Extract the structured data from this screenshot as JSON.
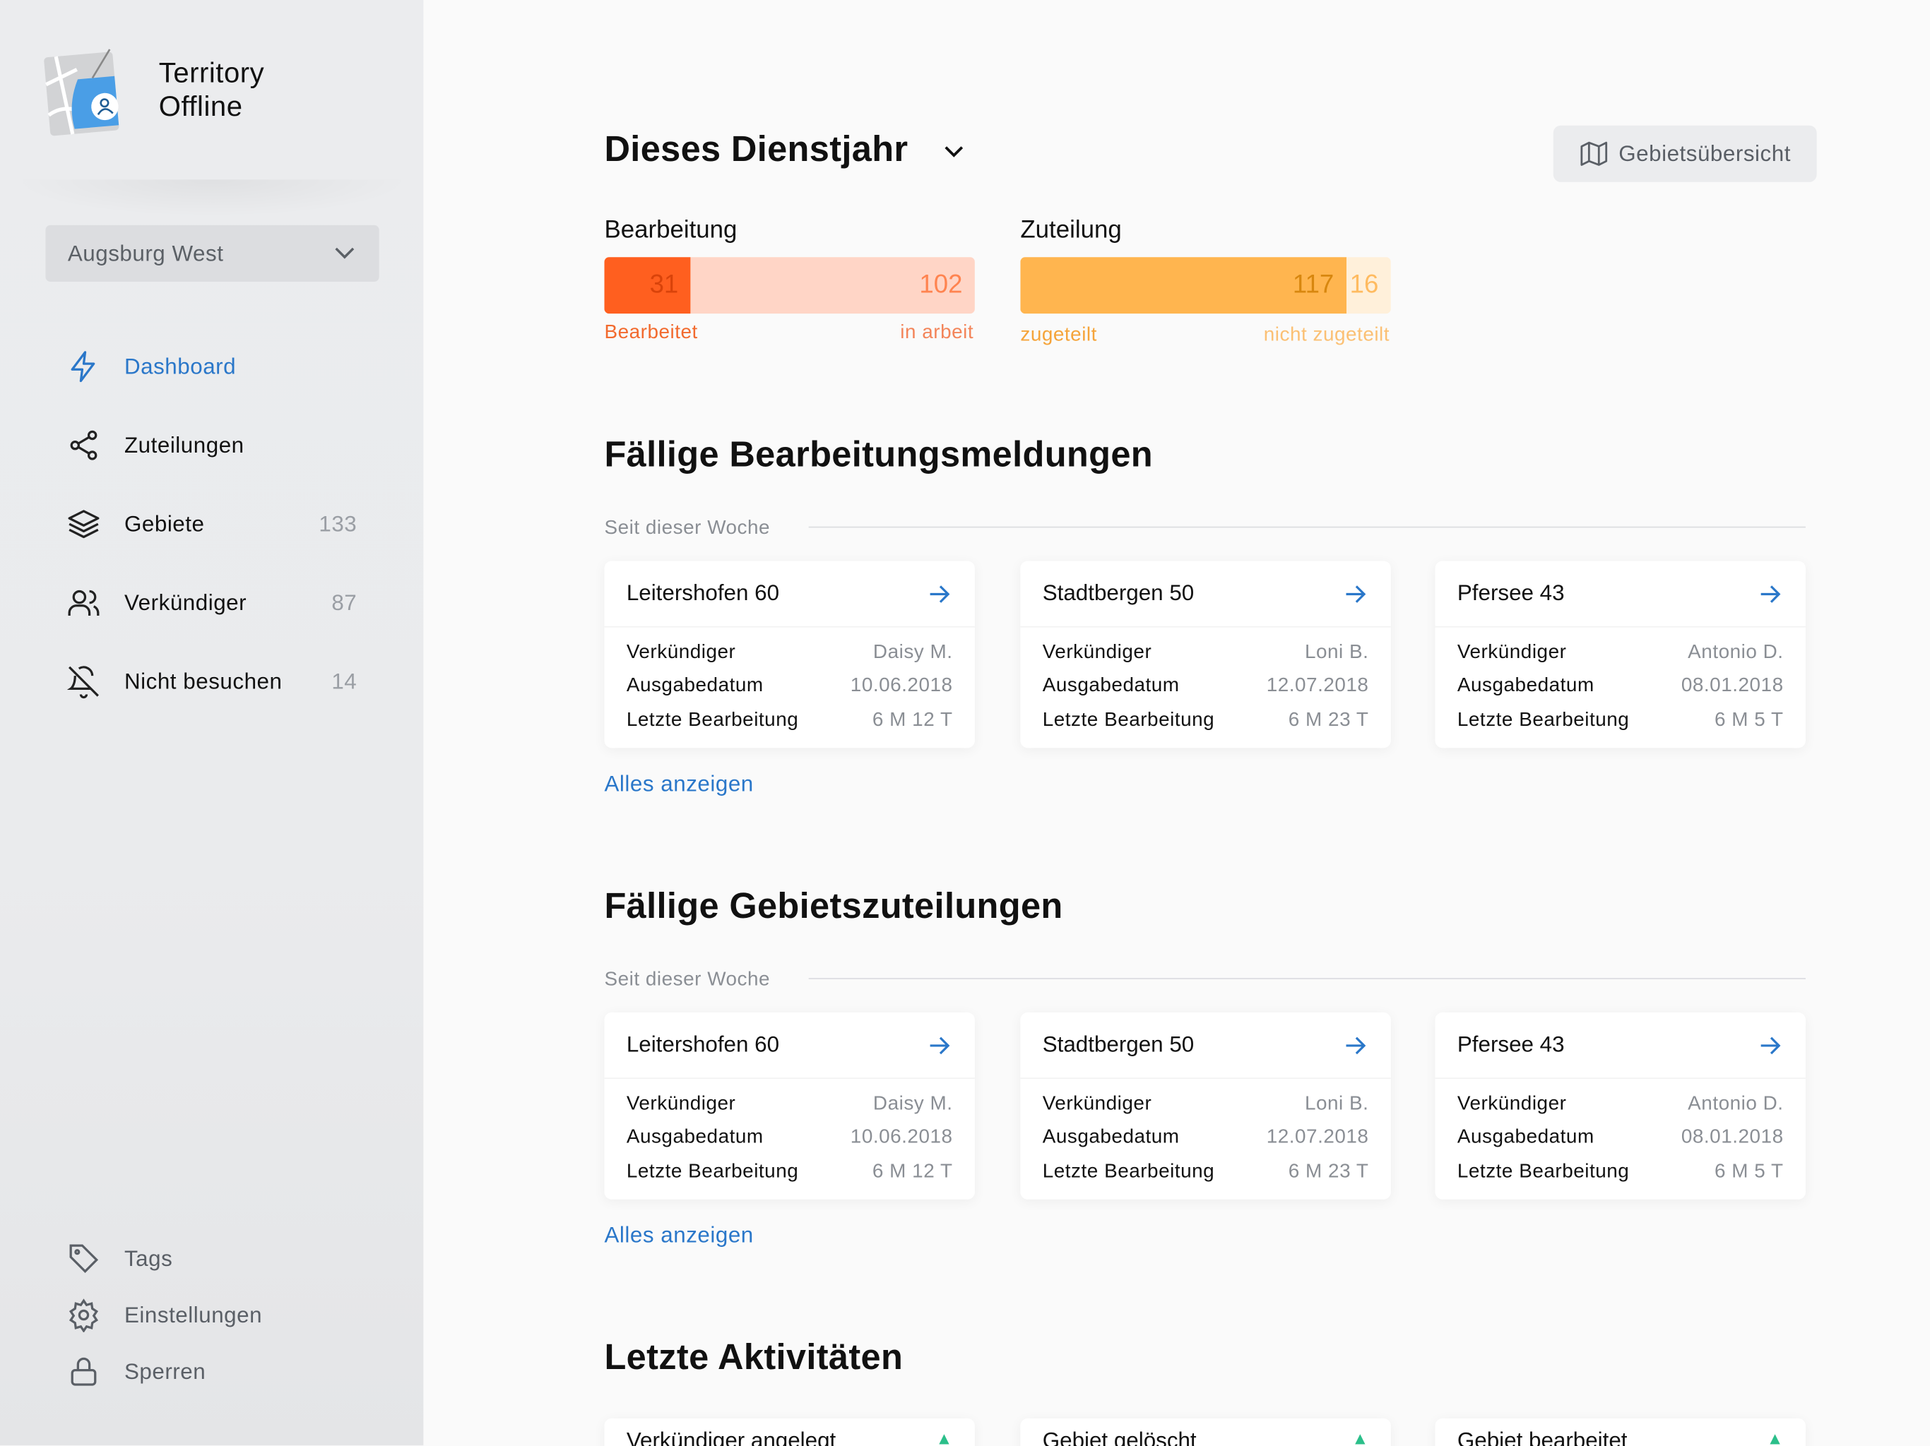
{
  "app": {
    "title_line1": "Territory",
    "title_line2": "Offline"
  },
  "congregation_select": {
    "value": "Augsburg West"
  },
  "nav": [
    {
      "label": "Dashboard",
      "count": null
    },
    {
      "label": "Zuteilungen",
      "count": null
    },
    {
      "label": "Gebiete",
      "count": "133"
    },
    {
      "label": "Verkündiger",
      "count": "87"
    },
    {
      "label": "Nicht besuchen",
      "count": "14"
    }
  ],
  "bottom_nav": [
    {
      "label": "Tags"
    },
    {
      "label": "Einstellungen"
    },
    {
      "label": "Sperren"
    }
  ],
  "header": {
    "title": "Dieses Dienstjahr",
    "map_button": "Gebietsübersicht"
  },
  "stats": {
    "processing": {
      "title": "Bearbeitung",
      "done": 31,
      "in_progress": 102,
      "done_label": "Bearbeitet",
      "in_progress_label": "in arbeit",
      "colors": {
        "done": "#ff5f1f",
        "rest": "#ffd5c6"
      }
    },
    "assignment": {
      "title": "Zuteilung",
      "assigned": 117,
      "unassigned": 16,
      "assigned_label": "zugeteilt",
      "unassigned_label": "nicht zugeteilt",
      "colors": {
        "done": "#ffb54f",
        "rest": "#fff0da"
      }
    }
  },
  "due_reports": {
    "title": "Fällige Bearbeitungsmeldungen",
    "subtitle": "Seit dieser Woche",
    "show_all": "Alles anzeigen",
    "cards": [
      {
        "title": "Leitershofen 60",
        "rows": [
          [
            "Verkündiger",
            "Daisy M."
          ],
          [
            "Ausgabedatum",
            "10.06.2018"
          ],
          [
            "Letzte Bearbeitung",
            "6 M 12 T"
          ]
        ]
      },
      {
        "title": "Stadtbergen 50",
        "rows": [
          [
            "Verkündiger",
            "Loni B."
          ],
          [
            "Ausgabedatum",
            "12.07.2018"
          ],
          [
            "Letzte Bearbeitung",
            "6 M 23 T"
          ]
        ]
      },
      {
        "title": "Pfersee 43",
        "rows": [
          [
            "Verkündiger",
            "Antonio D."
          ],
          [
            "Ausgabedatum",
            "08.01.2018"
          ],
          [
            "Letzte Bearbeitung",
            "6 M 5 T"
          ]
        ]
      }
    ]
  },
  "due_assignments": {
    "title": "Fällige Gebietszuteilungen",
    "subtitle": "Seit dieser Woche",
    "show_all": "Alles anzeigen",
    "cards": [
      {
        "title": "Leitershofen 60",
        "rows": [
          [
            "Verkündiger",
            "Daisy M."
          ],
          [
            "Ausgabedatum",
            "10.06.2018"
          ],
          [
            "Letzte Bearbeitung",
            "6 M 12 T"
          ]
        ]
      },
      {
        "title": "Stadtbergen 50",
        "rows": [
          [
            "Verkündiger",
            "Loni B."
          ],
          [
            "Ausgabedatum",
            "12.07.2018"
          ],
          [
            "Letzte Bearbeitung",
            "6 M 23 T"
          ]
        ]
      },
      {
        "title": "Pfersee 43",
        "rows": [
          [
            "Verkündiger",
            "Antonio D."
          ],
          [
            "Ausgabedatum",
            "08.01.2018"
          ],
          [
            "Letzte Bearbeitung",
            "6 M 5 T"
          ]
        ]
      }
    ]
  },
  "activities": {
    "title": "Letzte Aktivitäten",
    "cards": [
      {
        "title": "Verkündiger angelegt"
      },
      {
        "title": "Gebiet gelöscht"
      },
      {
        "title": "Gebiet bearbeitet"
      }
    ]
  }
}
